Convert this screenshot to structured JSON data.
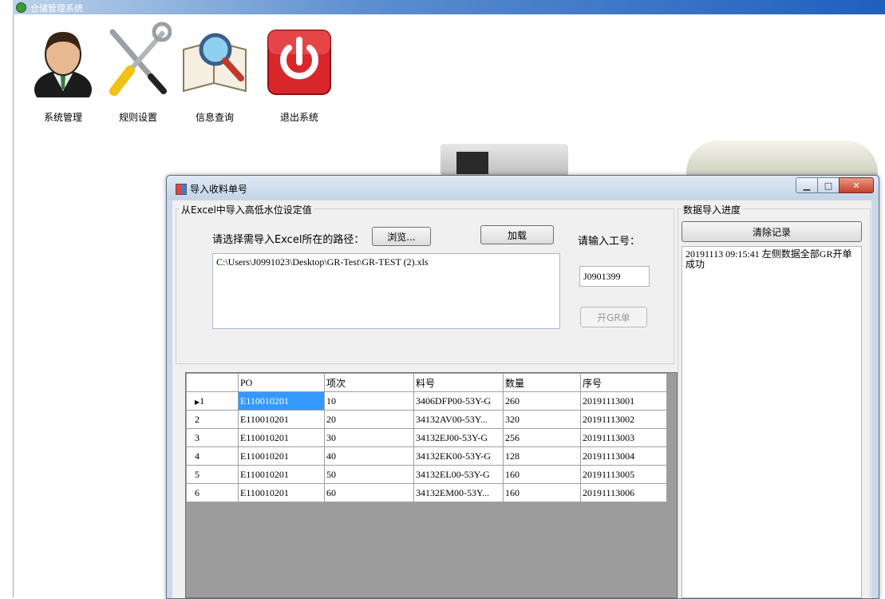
{
  "app": {
    "title": "仓储管理系统"
  },
  "toolbar": [
    {
      "label": "系统管理",
      "icon": "user-icon"
    },
    {
      "label": "规则设置",
      "icon": "tools-icon"
    },
    {
      "label": "信息查询",
      "icon": "magnifier-book-icon"
    },
    {
      "label": "退出系统",
      "icon": "power-icon"
    }
  ],
  "dialog": {
    "title": "导入收料单号",
    "import_group": {
      "legend": "从Excel中导入高低水位设定值",
      "path_label": "请选择需导入Excel所在的路径：",
      "browse_button": "浏览...",
      "load_button": "加载",
      "path_value": "C:\\Users\\J0991023\\Desktop\\GR-Test\\GR-TEST (2).xls",
      "employee_label": "请输入工号：",
      "employee_value": "J0901399",
      "open_gr_button": "开GR单"
    },
    "grid": {
      "columns": [
        "PO",
        "项次",
        "料号",
        "数量",
        "序号"
      ],
      "rows": [
        {
          "row": "1",
          "po": "E110010201",
          "item": "10",
          "part": "3406DFP00-53Y-G",
          "qty": "260",
          "seq": "20191113001"
        },
        {
          "row": "2",
          "po": "E110010201",
          "item": "20",
          "part": "34132AV00-53Y...",
          "qty": "320",
          "seq": "20191113002"
        },
        {
          "row": "3",
          "po": "E110010201",
          "item": "30",
          "part": "34132EJ00-53Y-G",
          "qty": "256",
          "seq": "20191113003"
        },
        {
          "row": "4",
          "po": "E110010201",
          "item": "40",
          "part": "34132EK00-53Y-G",
          "qty": "128",
          "seq": "20191113004"
        },
        {
          "row": "5",
          "po": "E110010201",
          "item": "50",
          "part": "34132EL00-53Y-G",
          "qty": "160",
          "seq": "20191113005"
        },
        {
          "row": "6",
          "po": "E110010201",
          "item": "60",
          "part": "34132EM00-53Y...",
          "qty": "160",
          "seq": "20191113006"
        }
      ],
      "current_row_marker": "▶"
    },
    "progress_group": {
      "legend": "数据导入进度",
      "clear_button": "清除记录",
      "log_text": "20191113 09:15:41 左侧数据全部GR开单成功"
    }
  }
}
